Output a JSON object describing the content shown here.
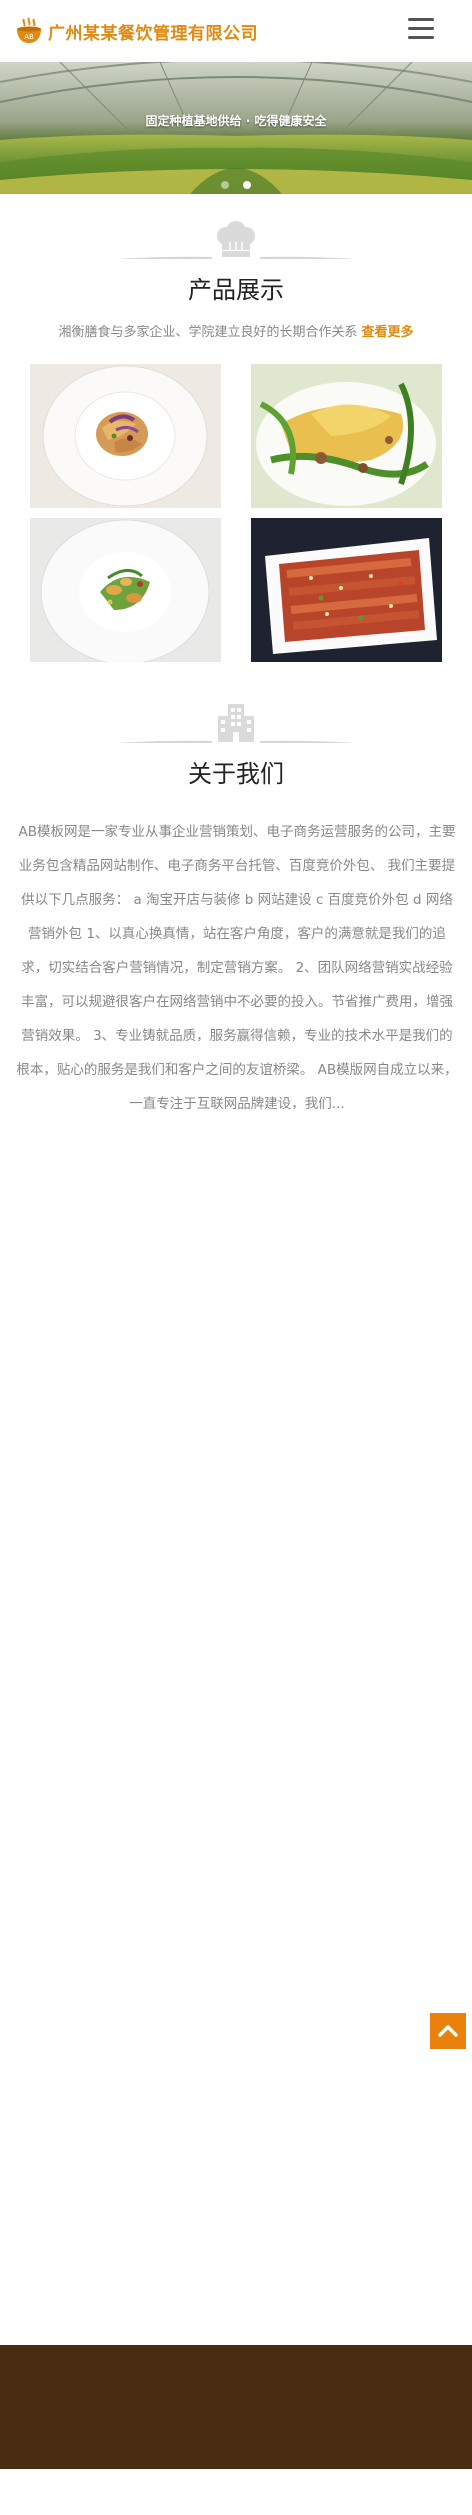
{
  "header": {
    "logo_text": "广州某某餐饮管理有限公司",
    "logo_icon": "chef-pot-icon",
    "menu_icon": "hamburger-menu-icon"
  },
  "banner": {
    "caption": "固定种植基地供给 · 吃得健康安全",
    "slide_count": 2,
    "active_slide": 2
  },
  "products": {
    "title": "产品展示",
    "icon": "chef-hat-icon",
    "subtitle": "湘衡膳食与多家企业、学院建立良好的长期合作关系",
    "more_link": "查看更多",
    "items": [
      {
        "icon": "pasta-plate-image"
      },
      {
        "icon": "dumpling-greens-image"
      },
      {
        "icon": "salad-plate-image"
      },
      {
        "icon": "sliced-meat-chili-image"
      }
    ]
  },
  "about": {
    "title": "关于我们",
    "icon": "building-icon",
    "body": "AB模板网是一家专业从事企业营销策划、电子商务运营服务的公司，主要业务包含精品网站制作、电子商务平台托管、百度竞价外包、 我们主要提供以下几点服务： a 淘宝开店与装修 b 网站建设 c 百度竞价外包 d 网络营销外包 1、以真心换真情，站在客户角度，客户的满意就是我们的追求，切实结合客户营销情况，制定营销方案。 2、团队网络营销实战经验丰富，可以规避很客户在网络营销中不必要的投入。节省推广费用，增强营销效果。 3、专业铸就品质，服务赢得信赖，专业的技术水平是我们的根本，贴心的服务是我们和客户之间的友谊桥梁。 AB模版网自成立以来，一直专注于互联网品牌建设，我们..."
  },
  "back_to_top": {
    "icon": "chevron-up-icon"
  },
  "colors": {
    "accent": "#e08a12",
    "back_to_top": "#e8820c",
    "footer": "#482c11",
    "muted_text": "#888888"
  }
}
